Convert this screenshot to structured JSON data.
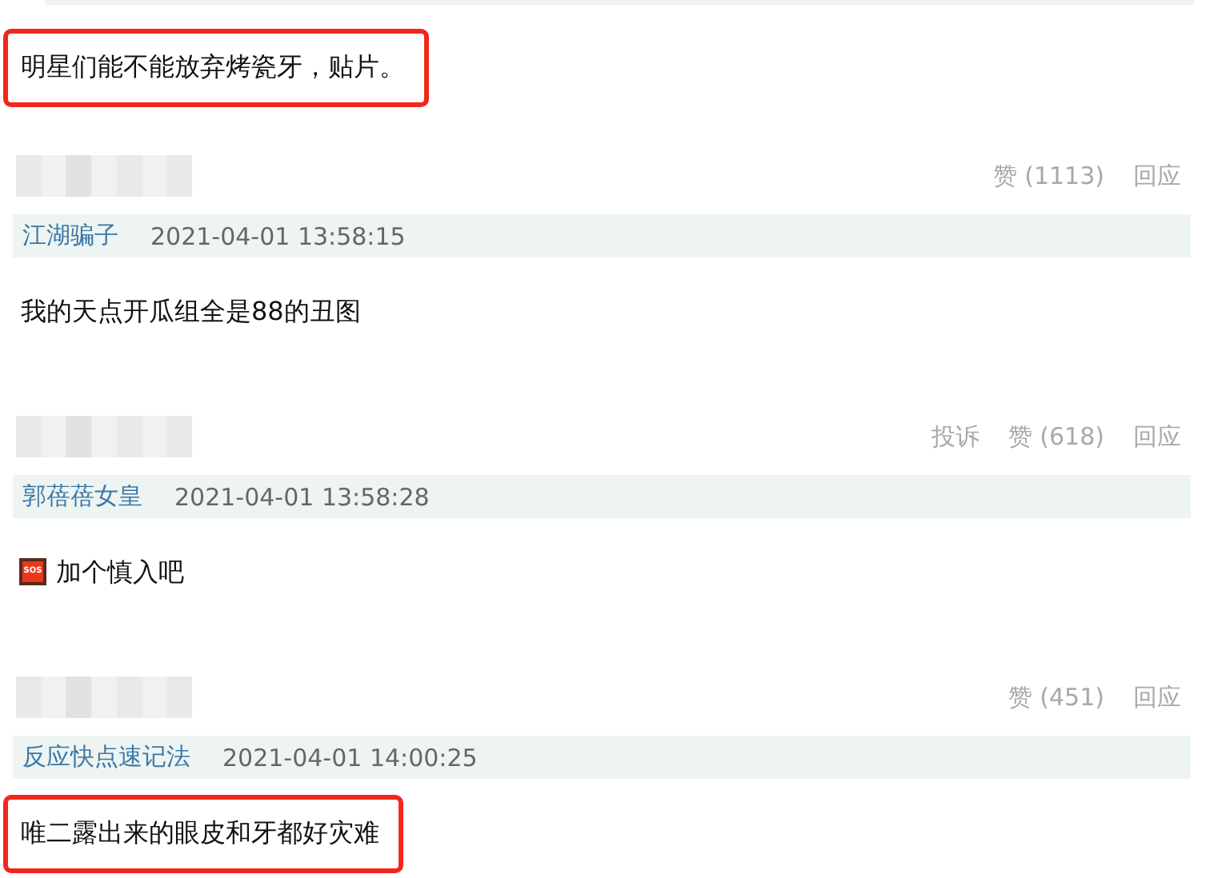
{
  "comments": [
    {
      "text": "明星们能不能放弃烤瓷牙，贴片。",
      "highlighted": true
    },
    {
      "actions": [
        "赞 (1113)",
        "回应"
      ],
      "author": "江湖骗子",
      "time": "2021-04-01 13:58:15",
      "text": "我的天点开瓜组全是88的丑图",
      "highlighted": false
    },
    {
      "actions": [
        "投诉",
        "赞 (618)",
        "回应"
      ],
      "author": "郭蓓蓓女皇",
      "time": "2021-04-01 13:58:28",
      "emoji": "SOS",
      "text": "加个慎入吧",
      "highlighted": false
    },
    {
      "actions": [
        "赞 (451)",
        "回应"
      ],
      "author": "反应快点速记法",
      "time": "2021-04-01 14:00:25",
      "text": "唯二露出来的眼皮和牙都好灾难",
      "highlighted": true
    }
  ]
}
